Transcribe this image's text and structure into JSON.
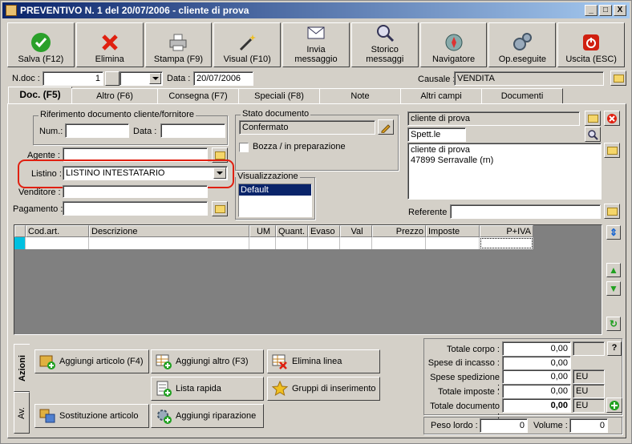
{
  "window": {
    "title": "PREVENTIVO N. 1  del 20/07/2006 - cliente di prova",
    "minimize": "_",
    "maximize": "□",
    "close": "X"
  },
  "toolbar": [
    {
      "label": "Salva (F12)",
      "icon": "check-icon"
    },
    {
      "label": "Elimina",
      "icon": "delete-x-icon"
    },
    {
      "label": "Stampa (F9)",
      "icon": "printer-icon"
    },
    {
      "label": "Visual (F10)",
      "icon": "magic-wand-icon"
    },
    {
      "label": "Invia\nmessaggio",
      "icon": "send-message-icon"
    },
    {
      "label": "Storico\nmessaggi",
      "icon": "message-history-icon"
    },
    {
      "label": "Navigatore",
      "icon": "compass-icon"
    },
    {
      "label": "Op.eseguite",
      "icon": "gears-icon"
    },
    {
      "label": "Uscita (ESC)",
      "icon": "power-icon"
    }
  ],
  "header": {
    "ndoc_label": "N.doc :",
    "ndoc_value": "1",
    "data_label": "Data :",
    "data_value": "20/07/2006",
    "causale_label": "Causale :",
    "causale_value": "VENDITA"
  },
  "tabs": [
    "Doc. (F5)",
    "Altro (F6)",
    "Consegna (F7)",
    "Speciali (F8)",
    "Note",
    "Altri campi",
    "Documenti"
  ],
  "riferimento": {
    "title": "Riferimento documento cliente/fornitore",
    "num_label": "Num.:",
    "num_value": "",
    "data_label": "Data :",
    "data_value": ""
  },
  "fields": {
    "agente_label": "Agente :",
    "agente_value": "",
    "listino_label": "Listino :",
    "listino_value": "LISTINO INTESTATARIO",
    "venditore_label": "Venditore :",
    "venditore_value": "",
    "pagamento_label": "Pagamento :",
    "pagamento_value": ""
  },
  "stato": {
    "title": "Stato documento",
    "value": "Confermato",
    "bozza_label": "Bozza / in preparazione"
  },
  "visualizzazione": {
    "title": "Visualizzazione",
    "selected": "Default"
  },
  "cliente": {
    "name": "cliente di prova",
    "greeting": "Spett.le",
    "address_line1": "cliente di prova",
    "address_line2": "47899 Serravalle (rn)",
    "referente_label": "Referente :",
    "referente_value": ""
  },
  "grid": {
    "columns": [
      "Cod.art.",
      "Descrizione",
      "UM",
      "Quant.",
      "Evaso",
      "Val",
      "Prezzo",
      "Imposte",
      "P+IVA"
    ]
  },
  "actions": {
    "tab_azioni": "Azioni",
    "tab_av": "Av.",
    "aggiungi_articolo": "Aggiungi articolo (F4)",
    "aggiungi_altro": "Aggiungi altro (F3)",
    "elimina_linea": "Elimina linea",
    "lista_rapida": "Lista rapida",
    "gruppi": "Gruppi di inserimento",
    "sostituzione": "Sostituzione articolo",
    "riparazione": "Aggiungi riparazione"
  },
  "totals": {
    "corpo_label": "Totale corpo :",
    "corpo": "0,00",
    "incasso_label": "Spese di incasso :",
    "incasso": "0,00",
    "spedizione_label": "Spese spedizione :",
    "spedizione": "0,00",
    "spedizione_cur": "EU",
    "imposte_label": "Totale imposte :",
    "imposte": "0,00",
    "imposte_cur": "EU",
    "documento_label": "Totale documento :",
    "documento": "0,00",
    "documento_cur": "EU",
    "help": "?",
    "peso_label": "Peso lordo :",
    "peso": "0",
    "volume_label": "Volume :",
    "volume": "0"
  }
}
